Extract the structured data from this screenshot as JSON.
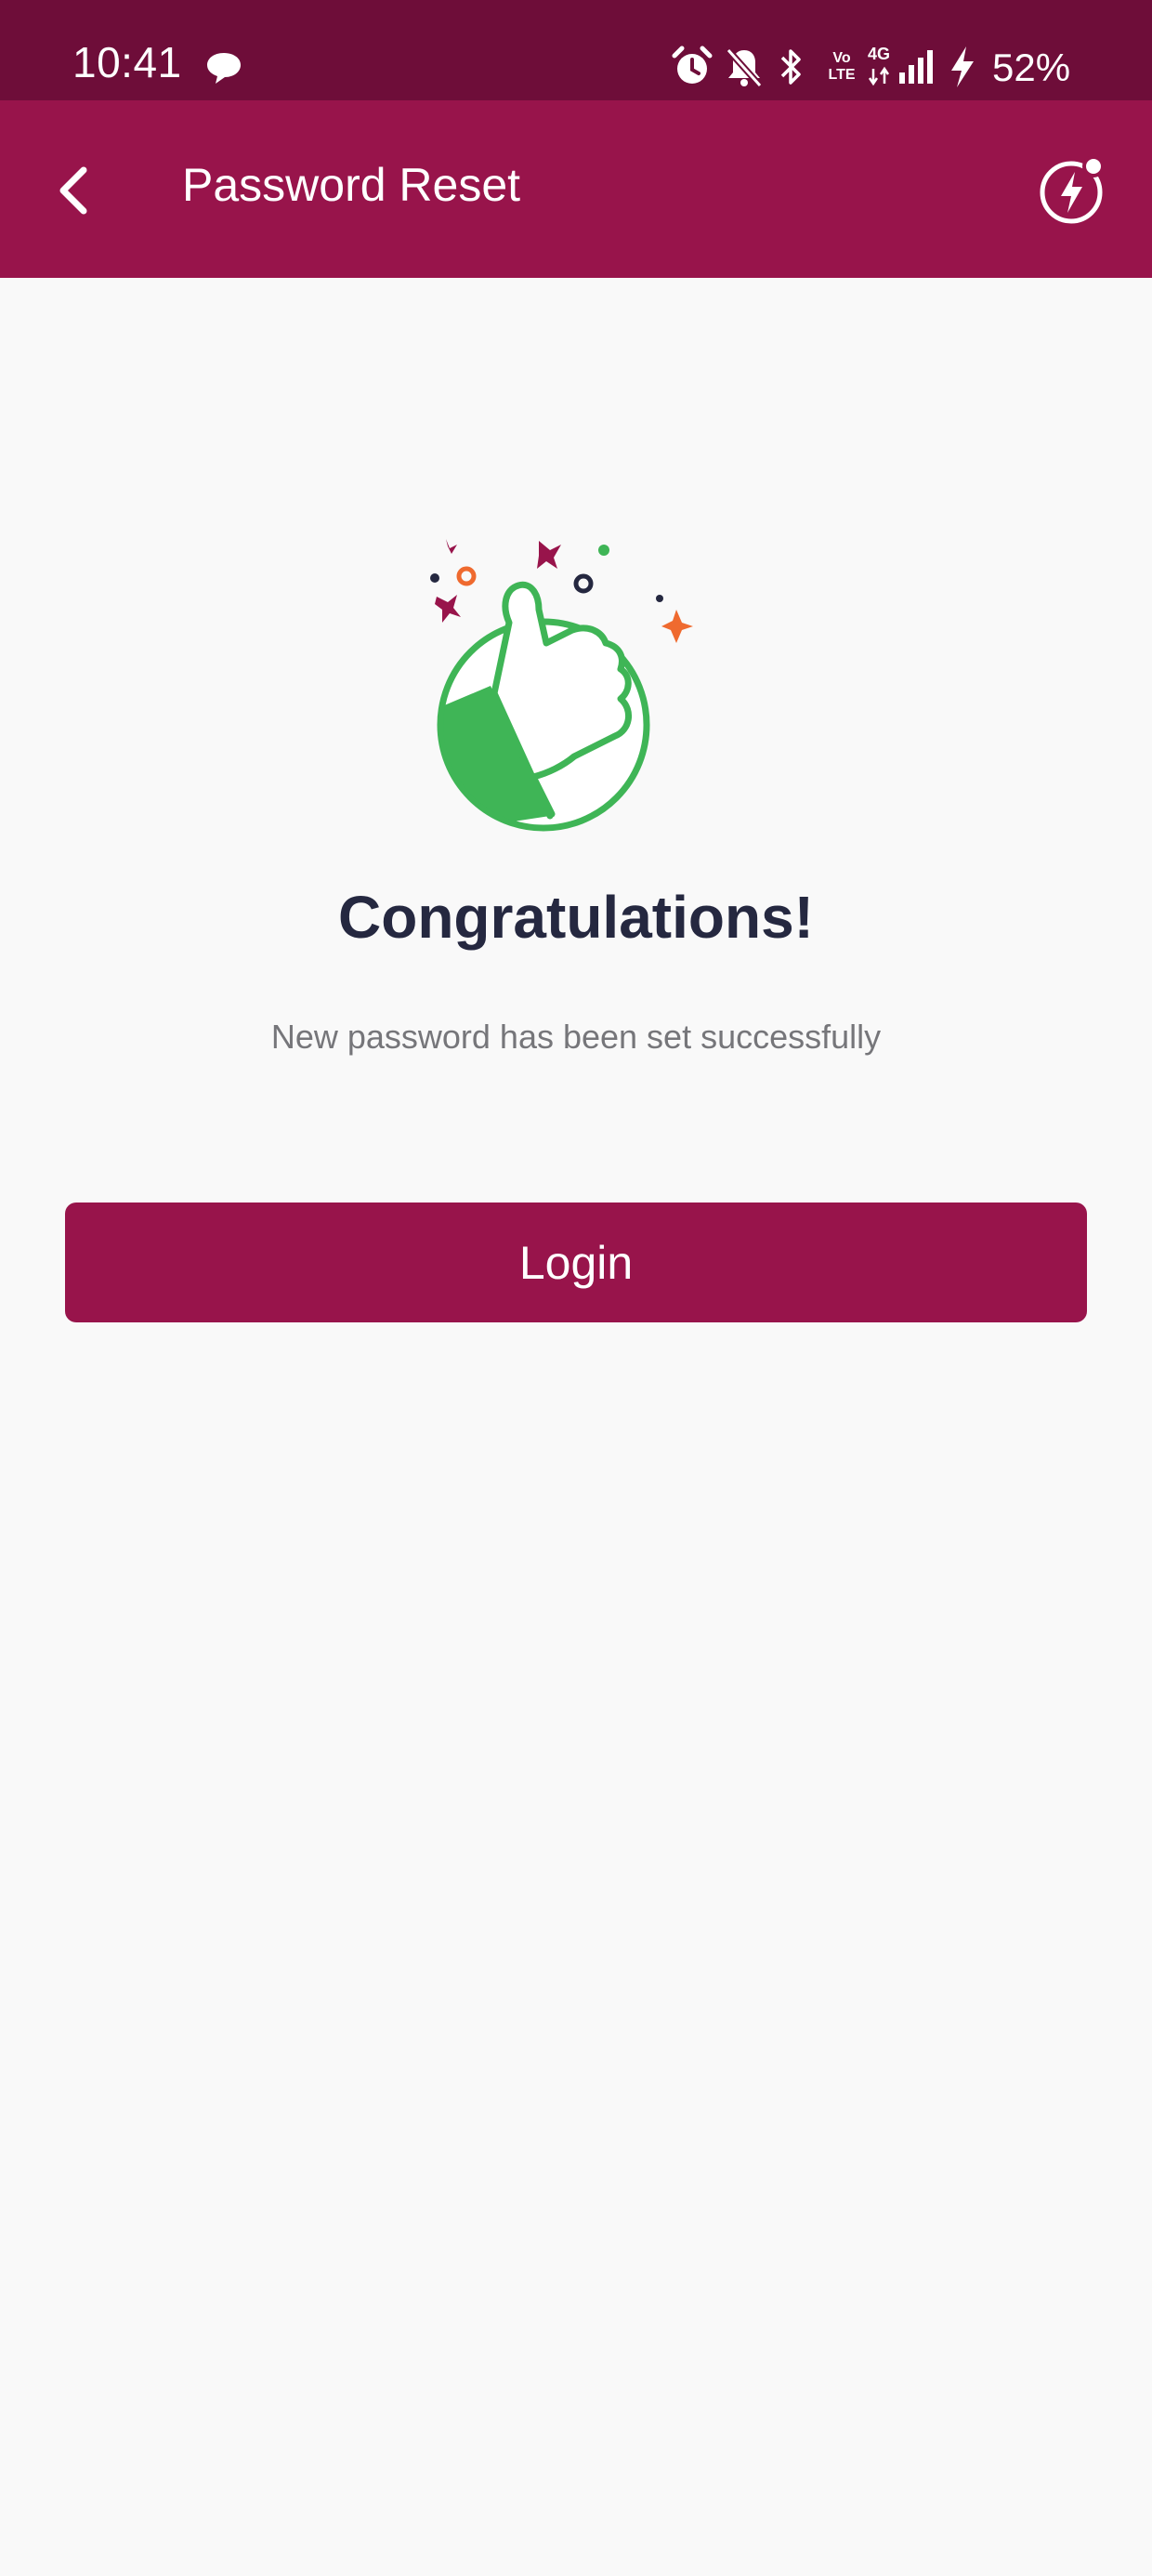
{
  "status_bar": {
    "time": "10:41",
    "battery_percent": "52%",
    "network_label": "4G",
    "volte_label": "Vo LTE",
    "icons": [
      "chat-icon",
      "alarm-icon",
      "bell-off-icon",
      "bluetooth-icon",
      "volte-icon",
      "signal-4g-icon",
      "charging-icon"
    ]
  },
  "app_bar": {
    "title": "Password Reset",
    "back_icon": "chevron-left-icon",
    "action_icon": "flash-icon"
  },
  "content": {
    "illustration": "thumbs-up-icon",
    "heading": "Congratulations!",
    "message": "New password has been set successfully",
    "login_label": "Login"
  },
  "colors": {
    "status_bar": "#6e0d39",
    "primary": "#98144b",
    "background": "#f9f9f9",
    "heading_text": "#252840",
    "message_text": "#76767a",
    "accent_green": "#3fb556",
    "accent_orange": "#ef6a2f"
  }
}
